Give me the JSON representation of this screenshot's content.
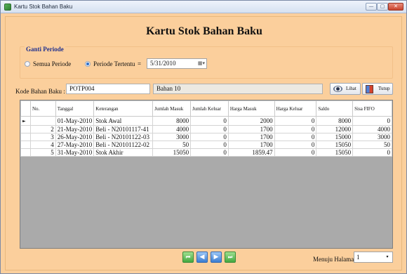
{
  "window": {
    "title": "Kartu Stok Bahan Baku",
    "btn_min": "—",
    "btn_max": "▢",
    "btn_close": "✕"
  },
  "header": {
    "title": "Kartu Stok Bahan Baku"
  },
  "period": {
    "legend": "Ganti Periode",
    "option_all": "Semua Periode",
    "option_specific": "Periode Tertentu",
    "selected": "Periode Tertentu",
    "eq": "=",
    "date": "5/31/2010",
    "date_btn": "▦▾"
  },
  "material": {
    "code_label": "Kode Bahan Baku :",
    "code_value": "POTP004",
    "name_value": "Bahan 10"
  },
  "buttons": {
    "view": "Lihat",
    "close": "Tutup"
  },
  "table": {
    "columns": [
      "No.",
      "Tanggal",
      "Keterangan",
      "Jumlah Masuk",
      "Jumlah Keluar",
      "Harga Masuk",
      "Harga Keluar",
      "Saldo",
      "Sisa FIFO"
    ],
    "current_row_marker": "►",
    "rows": [
      [
        "1",
        "01-May-2010",
        "Stok Awal",
        "8000",
        "0",
        "2000",
        "0",
        "8000",
        "0"
      ],
      [
        "2",
        "21-May-2010",
        "Beli - N20101117-41",
        "4000",
        "0",
        "1700",
        "0",
        "12000",
        "4000"
      ],
      [
        "3",
        "26-May-2010",
        "Beli - N20101122-03",
        "3000",
        "0",
        "1700",
        "0",
        "15000",
        "3000"
      ],
      [
        "4",
        "27-May-2010",
        "Beli - N20101122-02",
        "50",
        "0",
        "1700",
        "0",
        "15050",
        "50"
      ],
      [
        "5",
        "31-May-2010",
        "Stok Akhir",
        "15050",
        "0",
        "1859.47",
        "0",
        "15050",
        "0"
      ]
    ]
  },
  "footer": {
    "page_label": "Menuju Halaman :",
    "page_value": "1",
    "caret": "▾"
  }
}
